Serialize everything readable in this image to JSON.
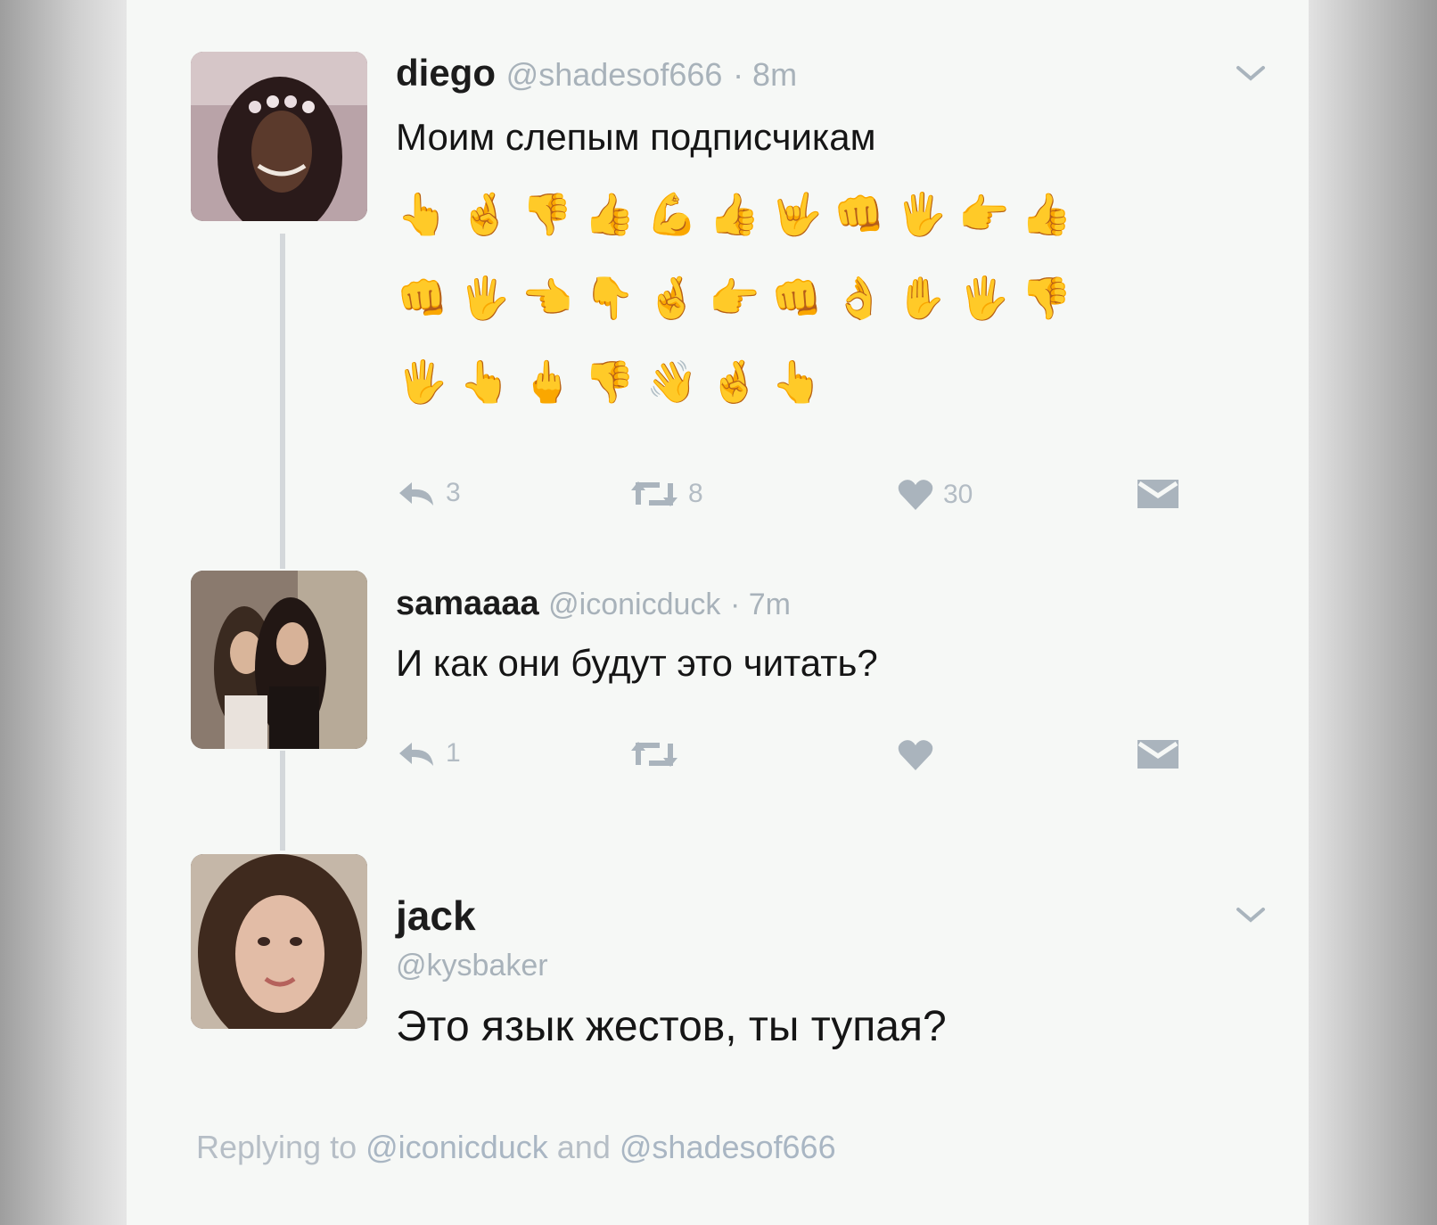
{
  "tweets": [
    {
      "name": "diego",
      "handle": "@shadesof666",
      "time": "· 8m",
      "text": "Моим слепым подписчикам",
      "emoji_rows": [
        [
          "👆",
          "🤞",
          "👎",
          "👍",
          "💪",
          "👍",
          "🤟",
          "👊",
          "🖐",
          "👉",
          "👍"
        ],
        [
          "👊",
          "🖐",
          "👈",
          "👇",
          "🤞",
          "👉",
          "👊",
          "👌",
          "✋",
          "🖐",
          "👎"
        ],
        [
          "🖐",
          "👆",
          "🖕",
          "👎",
          "👋",
          "🤞",
          "👆"
        ]
      ],
      "actions": {
        "reply": "3",
        "retweet": "8",
        "like": "30"
      }
    },
    {
      "name": "samaaaa",
      "handle": "@iconicduck",
      "time": "· 7m",
      "text": "И как они будут это читать?",
      "actions": {
        "reply": "1",
        "retweet": "",
        "like": ""
      }
    },
    {
      "name": "jack",
      "handle": "@kysbaker",
      "text": "Это язык жестов, ты тупая?"
    }
  ],
  "replying": {
    "prefix": "Replying to",
    "mention1": "@iconicduck",
    "conjunction": "and",
    "mention2": "@shadesof666"
  },
  "icons": [
    "reply-icon",
    "retweet-icon",
    "like-icon",
    "message-icon",
    "chevron-down-icon"
  ]
}
